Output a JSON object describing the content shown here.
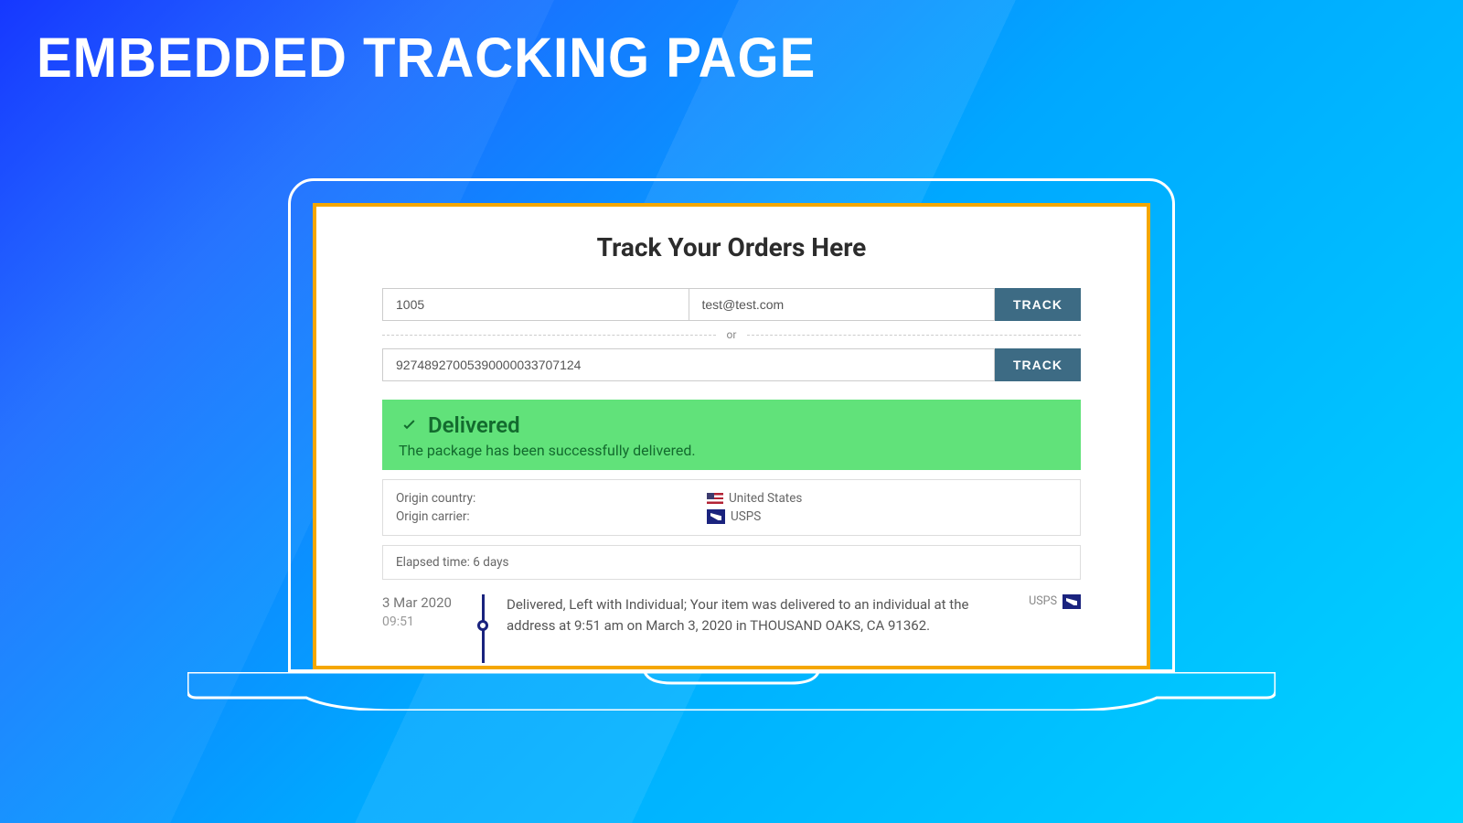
{
  "hero_title": "EMBEDDED TRACKING PAGE",
  "page": {
    "title": "Track Your Orders Here",
    "order_id": "1005",
    "email": "test@test.com",
    "track_label": "TRACK",
    "or_label": "or",
    "tracking_number": "92748927005390000033707124"
  },
  "status": {
    "title": "Delivered",
    "desc": "The package has been successfully delivered."
  },
  "info": {
    "origin_country_label": "Origin country:",
    "origin_country_value": "United States",
    "origin_carrier_label": "Origin carrier:",
    "origin_carrier_value": "USPS"
  },
  "elapsed": "Elapsed time: 6 days",
  "timeline": {
    "date": "3 Mar 2020",
    "time": "09:51",
    "text": "Delivered, Left with Individual; Your item was delivered to an individual at the address at 9:51 am on March 3, 2020 in THOUSAND OAKS, CA 91362.",
    "carrier": "USPS"
  }
}
